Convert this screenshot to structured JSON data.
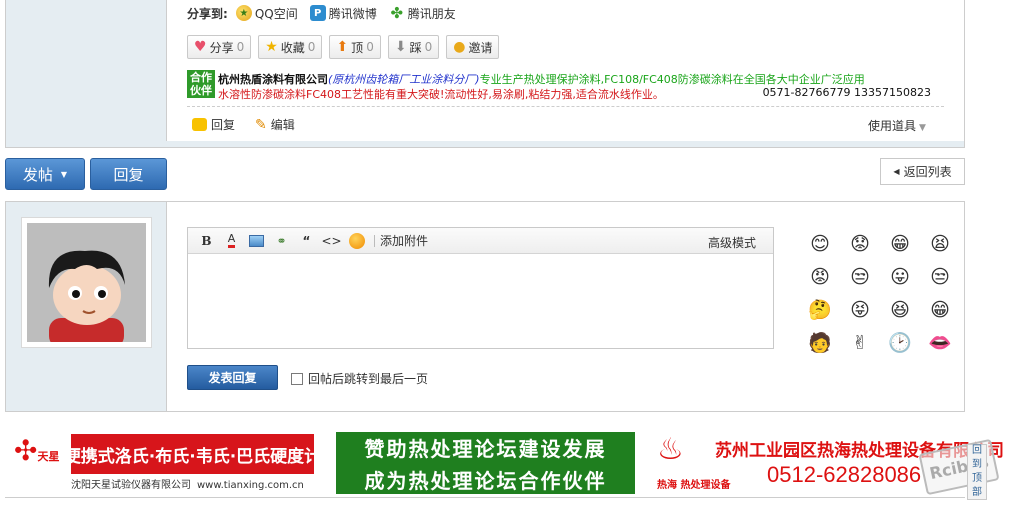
{
  "share": {
    "title": "分享到:",
    "links": [
      {
        "label": "QQ空间",
        "icon": "qzone-icon"
      },
      {
        "label": "腾讯微博",
        "icon": "tencent-weibo-icon"
      },
      {
        "label": "腾讯朋友",
        "icon": "tencent-pengyou-icon"
      }
    ]
  },
  "actions": [
    {
      "label": "分享",
      "count": "0",
      "icon": "heart-icon"
    },
    {
      "label": "收藏",
      "count": "0",
      "icon": "star-icon"
    },
    {
      "label": "顶",
      "count": "0",
      "icon": "up-arrow-icon"
    },
    {
      "label": "踩",
      "count": "0",
      "icon": "down-arrow-icon"
    },
    {
      "label": "邀请",
      "count": "",
      "icon": "invite-icon"
    }
  ],
  "ad": {
    "badge": "合作伙伴",
    "company": "杭州热盾涂料有限公司",
    "subsidiary": "(原杭州齿轮箱厂工业涂料分厂)",
    "line1_text": "专业生产热处理保护涂料,FC108/FC408防渗碳涂料在全国各大中企业广泛应用",
    "line2_text": "水溶性防渗碳涂料FC408工艺性能有重大突破!流动性好,易涂刷,粘结力强,适合流水线作业。",
    "phone": "0571-82766779 13357150823"
  },
  "post_footer": {
    "reply_label": "回复",
    "edit_label": "编辑",
    "tools_label": "使用道具"
  },
  "buttons": {
    "post_label": "发帖",
    "reply_label": "回复",
    "back_label": "返回列表"
  },
  "editor": {
    "attach_label": "添加附件",
    "advanced_label": "高级模式",
    "content": "",
    "submit_label": "发表回复",
    "jump_label": "回帖后跳转到最后一页",
    "jump_checked": false
  },
  "emoticons": [
    "😊",
    "😟",
    "😁",
    "😫",
    "😡",
    "😒",
    "😛",
    "😒",
    "🤔",
    "😝",
    "😆",
    "😁",
    "🧑",
    "✌",
    "🕑",
    "👄"
  ],
  "banners": {
    "b1_logo": "天星",
    "b1_main": "便携式洛氏·布氏·韦氏·巴氏硬度计",
    "b1_company": "沈阳天星试验仪器有限公司",
    "b1_url": "www.tianxing.com.cn",
    "b2_line1": "赞助热处理论坛建设发展",
    "b2_line2": "成为热处理论坛合作伙伴",
    "b3_logo": "热海",
    "b3_logo_sub": "热处理设备",
    "b3_name": "苏州工业园区热海热处理设备有限公司",
    "b3_phone": "0512-62828086"
  },
  "watermark": "Rcibbs",
  "sidetab": [
    "回",
    "到",
    "顶",
    "部"
  ]
}
